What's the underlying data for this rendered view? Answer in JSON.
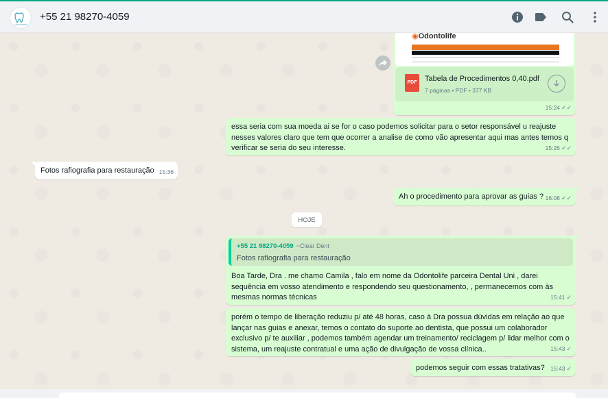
{
  "header": {
    "contact_name": "+55 21 98270-4059",
    "icons": [
      "info-icon",
      "label-icon",
      "search-icon",
      "menu-icon"
    ]
  },
  "messages": {
    "doc": {
      "logo_text": "Odontolife",
      "file_name": "Tabela de Procedimentos 0,40.pdf",
      "file_meta": "7 páginas • PDF • 377 KB",
      "badge": "PDF",
      "time": "15:24"
    },
    "m1": {
      "text": "essa seria com sua moeda ai se for o caso podemos solicitar para o setor responsável u reajuste nesses valores claro que tem que ocorrer a analise de como vão apresentar aqui mas antes temos q verificar se seria do seu interesse.",
      "time": "15:26"
    },
    "m2": {
      "text": "Fotos rafiografia para restauração",
      "time": "15:36"
    },
    "m3": {
      "text": "Ah o procedimento para aprovar as guias ?",
      "time": "16:08"
    },
    "date_divider": "HOJE",
    "m4": {
      "quote_author": "+55 21 98270-4059",
      "quote_alias": "~Clear Dent",
      "quote_text": "Fotos rafiografia para restauração",
      "text": "Boa Tarde, Dra . me chamo Camila , falo em nome da Odontolife parceira Dental Uni , darei sequência em vosso atendimento e respondendo seu questionamento, , permanecemos com às mesmas normas técnicas",
      "time": "15:41"
    },
    "m5": {
      "text": "porém o tempo de liberação reduziu p/ até 48 horas, caso à Dra possua dúvidas em relação ao que lançar nas guias e anexar, temos o contato do suporte ao dentista, que possui um colaborador exclusivo p/ te auxiliar , podemos também agendar um treinamento/ reciclagem p/ lidar melhor com o sistema, um reajuste contratual e uma ação de divulgação de vossa clínica..",
      "time": "15:43"
    },
    "m6": {
      "text": "podemos seguir com essas tratativas?",
      "time": "15:43"
    }
  },
  "colors": {
    "accent": "#00a884",
    "outgoing_bubble": "#d9fdd3",
    "incoming_bubble": "#ffffff",
    "pdf_red": "#e94b3c"
  }
}
